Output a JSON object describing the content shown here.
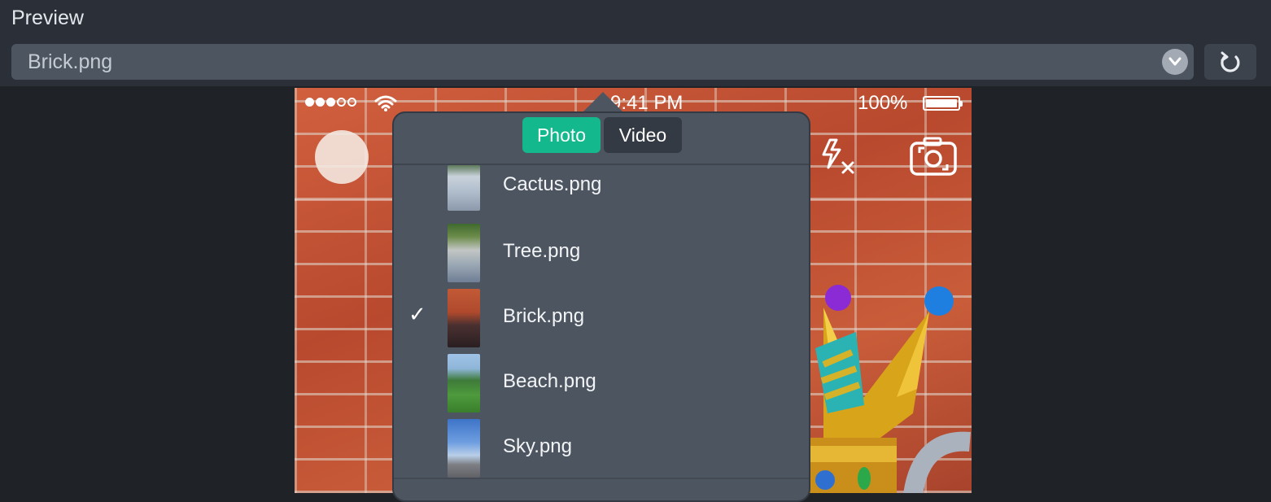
{
  "header": {
    "title": "Preview",
    "selected_file": "Brick.png"
  },
  "device": {
    "status_bar": {
      "time": "9:41 PM",
      "battery": "100%"
    }
  },
  "popover": {
    "tabs": [
      {
        "label": "Photo",
        "active": true
      },
      {
        "label": "Video",
        "active": false
      }
    ],
    "files": [
      {
        "name": "Cactus.png",
        "selected": false
      },
      {
        "name": "Tree.png",
        "selected": false
      },
      {
        "name": "Brick.png",
        "selected": true
      },
      {
        "name": "Beach.png",
        "selected": false
      },
      {
        "name": "Sky.png",
        "selected": false
      }
    ],
    "check_glyph": "✓"
  },
  "colors": {
    "accent": "#13b98c",
    "panel": "#4d5561",
    "toolbar": "#2b3038",
    "background": "#1f2328"
  },
  "icons": [
    "chevron-down-icon",
    "refresh-icon",
    "wifi-icon",
    "battery-icon",
    "flash-off-icon",
    "flip-camera-icon"
  ]
}
